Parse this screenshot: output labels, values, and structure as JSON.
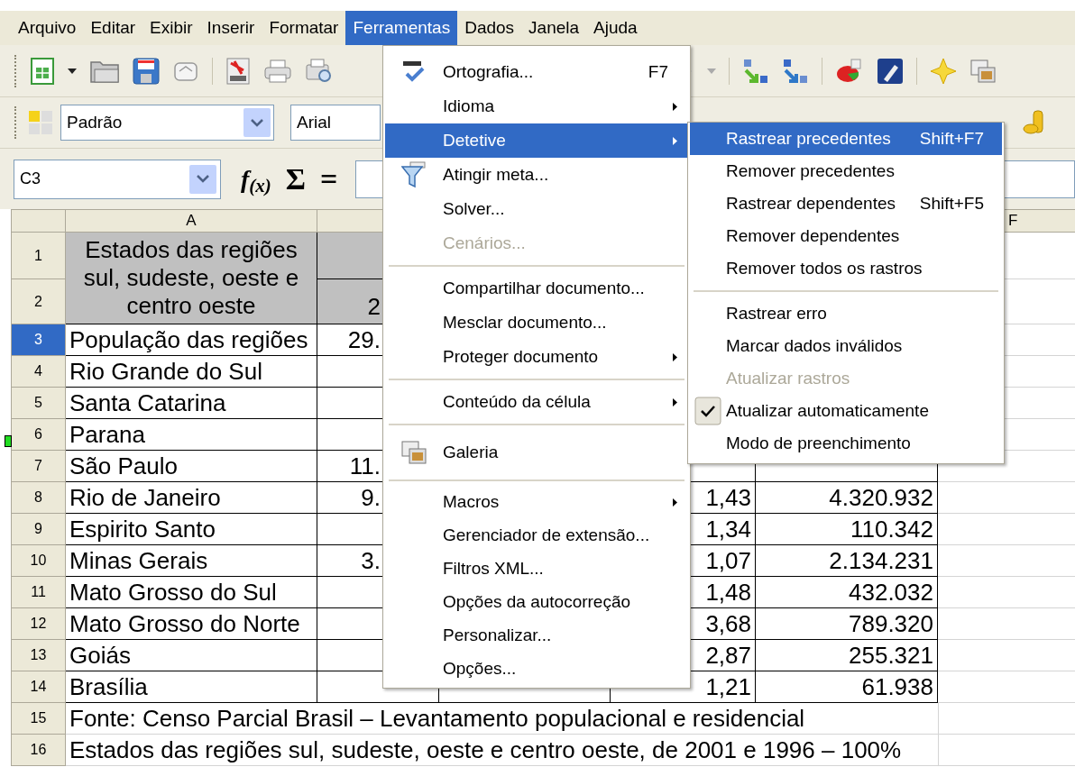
{
  "menubar": [
    {
      "label": "Arquivo",
      "selected": false
    },
    {
      "label": "Editar",
      "selected": false
    },
    {
      "label": "Exibir",
      "selected": false
    },
    {
      "label": "Inserir",
      "selected": false
    },
    {
      "label": "Formatar",
      "selected": false
    },
    {
      "label": "Ferramentas",
      "selected": true
    },
    {
      "label": "Dados",
      "selected": false
    },
    {
      "label": "Janela",
      "selected": false
    },
    {
      "label": "Ajuda",
      "selected": false
    }
  ],
  "toolbar": {
    "style_box": {
      "value": "Padrão"
    },
    "font_box": {
      "value": "Arial"
    }
  },
  "formula_bar": {
    "name_box": {
      "value": "C3"
    },
    "wizard": "f$_{(x)}$",
    "sum": "Σ",
    "equals": "="
  },
  "sheet": {
    "col_header_a": "A",
    "col_header_f": "F",
    "rows": [
      {
        "header": "1",
        "selected": false,
        "kind": "title",
        "a": "Estados das regiões sul, sudeste, oeste e centro oeste"
      },
      {
        "header": "2",
        "selected": false,
        "kind": "title",
        "b": "2"
      },
      {
        "header": "3",
        "selected": true,
        "kind": "data",
        "a": "População das regiões",
        "b": "29."
      },
      {
        "header": "4",
        "selected": false,
        "kind": "data",
        "a": "Rio Grande do Sul"
      },
      {
        "header": "5",
        "selected": false,
        "kind": "data",
        "a": "Santa Catarina"
      },
      {
        "header": "6",
        "selected": false,
        "kind": "data",
        "a": "Parana"
      },
      {
        "header": "7",
        "selected": false,
        "kind": "data",
        "a": "São Paulo",
        "b": "11."
      },
      {
        "header": "8",
        "selected": false,
        "kind": "data",
        "a": "Rio de Janeiro",
        "b": "9.",
        "d": "1,43",
        "e": "4.320.932"
      },
      {
        "header": "9",
        "selected": false,
        "kind": "data",
        "a": "Espirito Santo",
        "d": "1,34",
        "e": "110.342"
      },
      {
        "header": "10",
        "selected": false,
        "kind": "data",
        "a": "Minas Gerais",
        "b": "3.",
        "d": "1,07",
        "e": "2.134.231"
      },
      {
        "header": "11",
        "selected": false,
        "kind": "data",
        "a": "Mato Grosso do Sul",
        "d": "1,48",
        "e": "432.032"
      },
      {
        "header": "12",
        "selected": false,
        "kind": "data",
        "a": "Mato Grosso do Norte",
        "d": "3,68",
        "e": "789.320"
      },
      {
        "header": "13",
        "selected": false,
        "kind": "data",
        "a": "Goiás",
        "d": "2,87",
        "e": "255.321"
      },
      {
        "header": "14",
        "selected": false,
        "kind": "data",
        "a": "Brasília",
        "d": "1,21",
        "e": "61.938"
      },
      {
        "header": "15",
        "selected": false,
        "kind": "note",
        "text": "Fonte: Censo Parcial Brasil  – Levantamento populacional e residencial"
      },
      {
        "header": "16",
        "selected": false,
        "kind": "note",
        "text": "Estados das regiões sul, sudeste, oeste e centro oeste, de 2001 e 1996 – 100%"
      }
    ]
  },
  "tools_menu": [
    {
      "kind": "item",
      "label": "Ortografia...",
      "shortcut": "F7",
      "submenu": false,
      "disabled": false,
      "selected": false
    },
    {
      "kind": "item",
      "label": "Idioma",
      "submenu": true,
      "disabled": false,
      "selected": false
    },
    {
      "kind": "item",
      "label": "Detetive",
      "submenu": true,
      "disabled": false,
      "selected": true
    },
    {
      "kind": "item",
      "label": "Atingir meta...",
      "submenu": false,
      "disabled": false,
      "selected": false
    },
    {
      "kind": "item",
      "label": "Solver...",
      "submenu": false,
      "disabled": false,
      "selected": false
    },
    {
      "kind": "item",
      "label": "Cenários...",
      "submenu": false,
      "disabled": true,
      "selected": false
    },
    {
      "kind": "separator"
    },
    {
      "kind": "item",
      "label": "Compartilhar documento...",
      "submenu": false,
      "disabled": false,
      "selected": false
    },
    {
      "kind": "item",
      "label": "Mesclar documento...",
      "submenu": false,
      "disabled": false,
      "selected": false
    },
    {
      "kind": "item",
      "label": "Proteger documento",
      "submenu": true,
      "disabled": false,
      "selected": false
    },
    {
      "kind": "separator"
    },
    {
      "kind": "item",
      "label": "Conteúdo da célula",
      "submenu": true,
      "disabled": false,
      "selected": false
    },
    {
      "kind": "separator"
    },
    {
      "kind": "item",
      "label": "Galeria",
      "submenu": false,
      "disabled": false,
      "selected": false
    },
    {
      "kind": "separator"
    },
    {
      "kind": "item",
      "label": "Macros",
      "submenu": true,
      "disabled": false,
      "selected": false
    },
    {
      "kind": "item",
      "label": "Gerenciador de extensão...",
      "submenu": false,
      "disabled": false,
      "selected": false
    },
    {
      "kind": "item",
      "label": "Filtros XML...",
      "submenu": false,
      "disabled": false,
      "selected": false
    },
    {
      "kind": "item",
      "label": "Opções da autocorreção",
      "submenu": false,
      "disabled": false,
      "selected": false
    },
    {
      "kind": "item",
      "label": "Personalizar...",
      "submenu": false,
      "disabled": false,
      "selected": false
    },
    {
      "kind": "item",
      "label": "Opções...",
      "submenu": false,
      "disabled": false,
      "selected": false
    }
  ],
  "detective_menu": [
    {
      "kind": "item",
      "label": "Rastrear precedentes",
      "shortcut": "Shift+F7",
      "disabled": false,
      "selected": true,
      "checked": false
    },
    {
      "kind": "item",
      "label": "Remover precedentes",
      "disabled": false,
      "selected": false,
      "checked": false
    },
    {
      "kind": "item",
      "label": "Rastrear dependentes",
      "shortcut": "Shift+F5",
      "disabled": false,
      "selected": false,
      "checked": false
    },
    {
      "kind": "item",
      "label": "Remover dependentes",
      "disabled": false,
      "selected": false,
      "checked": false
    },
    {
      "kind": "item",
      "label": "Remover todos os rastros",
      "disabled": false,
      "selected": false,
      "checked": false
    },
    {
      "kind": "separator"
    },
    {
      "kind": "item",
      "label": "Rastrear erro",
      "disabled": false,
      "selected": false,
      "checked": false
    },
    {
      "kind": "item",
      "label": "Marcar dados inválidos",
      "disabled": false,
      "selected": false,
      "checked": false
    },
    {
      "kind": "item",
      "label": "Atualizar rastros",
      "disabled": true,
      "selected": false,
      "checked": false
    },
    {
      "kind": "item",
      "label": "Atualizar automaticamente",
      "disabled": false,
      "selected": false,
      "checked": true
    },
    {
      "kind": "item",
      "label": "Modo de preenchimento",
      "disabled": false,
      "selected": false,
      "checked": false
    }
  ]
}
